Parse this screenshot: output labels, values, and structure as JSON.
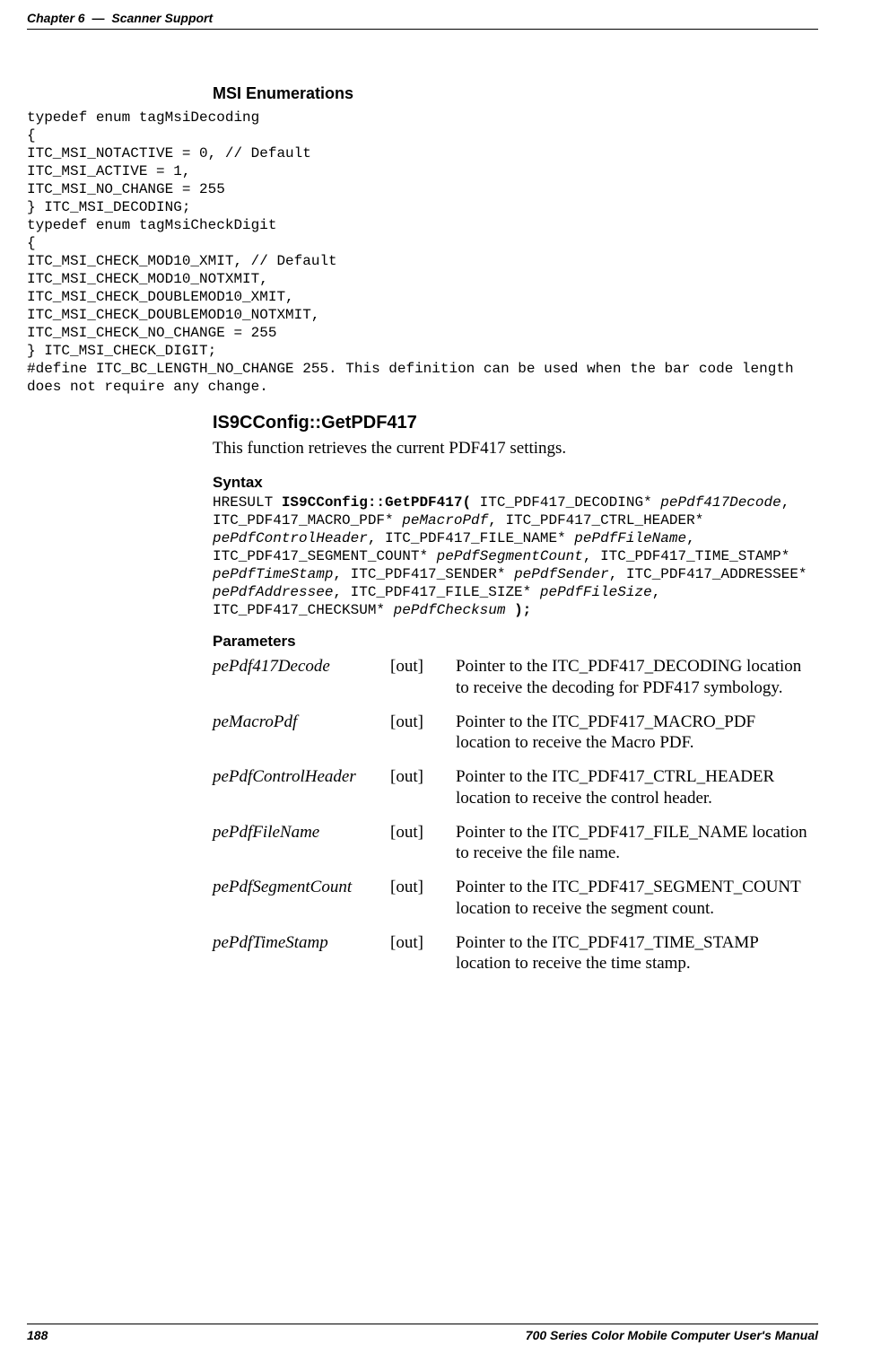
{
  "header": {
    "chapter": "Chapter 6",
    "sep": "—",
    "section": "Scanner Support"
  },
  "sections": {
    "msi_enum": {
      "title": "MSI Enumerations",
      "code": "typedef enum tagMsiDecoding\n{\nITC_MSI_NOTACTIVE = 0, // Default\nITC_MSI_ACTIVE = 1,\nITC_MSI_NO_CHANGE = 255\n} ITC_MSI_DECODING;\ntypedef enum tagMsiCheckDigit\n{\nITC_MSI_CHECK_MOD10_XMIT, // Default\nITC_MSI_CHECK_MOD10_NOTXMIT,\nITC_MSI_CHECK_DOUBLEMOD10_XMIT,\nITC_MSI_CHECK_DOUBLEMOD10_NOTXMIT,\nITC_MSI_CHECK_NO_CHANGE = 255\n} ITC_MSI_CHECK_DIGIT;\n#define ITC_BC_LENGTH_NO_CHANGE 255. This definition can be used when the bar code length does not require any change."
    },
    "getpdf": {
      "title": "IS9CConfig::GetPDF417",
      "desc": "This function retrieves the current PDF417 settings."
    },
    "syntax": {
      "title": "Syntax",
      "p1": "HRESULT ",
      "fn": "IS9CConfig::GetPDF417(",
      "rest1": " ITC_PDF417_DECODING* ",
      "a1": "pePdf417Decode",
      "rest2": ", ITC_PDF417_MACRO_PDF* ",
      "a2": "peMacroPdf",
      "rest3": ", ITC_PDF417_CTRL_HEADER* ",
      "a3": "pePdfControlHeader",
      "rest4": ", ITC_PDF417_FILE_NAME* ",
      "a4": "pePdfFileName",
      "rest5": ", ITC_PDF417_SEGMENT_COUNT* ",
      "a5": "pePdfSegmentCount",
      "rest6": ", ITC_PDF417_TIME_STAMP* ",
      "a6": "pePdfTimeStamp",
      "rest7": ", ITC_PDF417_SENDER* ",
      "a7": "pePdfSender",
      "rest8": ", ITC_PDF417_ADDRESSEE* ",
      "a8": "pePdfAddressee",
      "rest9": ", ITC_PDF417_FILE_SIZE* ",
      "a9": "pePdfFileSize",
      "rest10": ", ITC_PDF417_CHECKSUM* ",
      "a10": "pePdfChecksum",
      "end": " );"
    },
    "parameters": {
      "title": "Parameters",
      "rows": [
        {
          "name": "pePdf417Decode",
          "dir": "[out]",
          "desc": "Pointer to the ITC_PDF417_DECODING location to receive the decoding for PDF417 symbology."
        },
        {
          "name": "peMacroPdf",
          "dir": "[out]",
          "desc": "Pointer to the ITC_PDF417_MACRO_PDF location to receive the Macro PDF."
        },
        {
          "name": "pePdfControlHeader",
          "dir": "[out]",
          "desc": "Pointer to the ITC_PDF417_CTRL_HEADER location to receive the control header."
        },
        {
          "name": "pePdfFileName",
          "dir": "[out]",
          "desc": "Pointer to the ITC_PDF417_FILE_NAME location to receive the file name."
        },
        {
          "name": "pePdfSegmentCount",
          "dir": "[out]",
          "desc": "Pointer to the ITC_PDF417_SEGMENT_COUNT location to receive the segment count."
        },
        {
          "name": "pePdfTimeStamp",
          "dir": "[out]",
          "desc": "Pointer to the ITC_PDF417_TIME_STAMP location to receive the time stamp."
        }
      ]
    }
  },
  "footer": {
    "page": "188",
    "book": "700 Series Color Mobile Computer User's Manual"
  }
}
